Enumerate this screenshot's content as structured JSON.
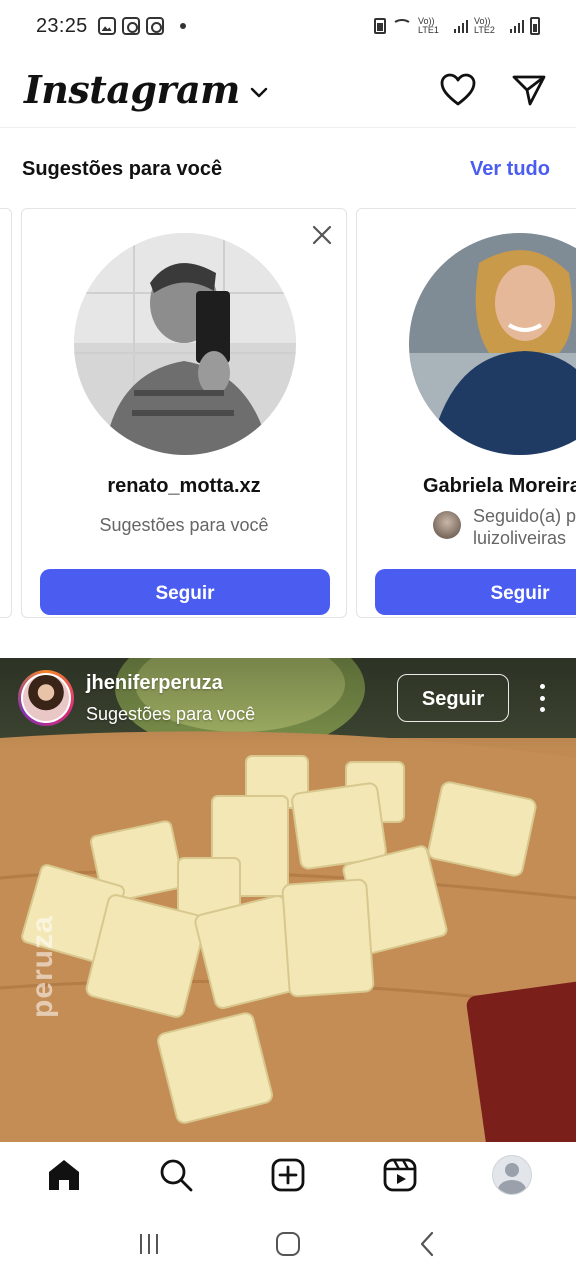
{
  "status_bar": {
    "time": "23:25",
    "net1": "Vo)) LTE1",
    "net2": "Vo)) LTE2"
  },
  "header": {
    "logo": "Instagram"
  },
  "suggestions": {
    "title": "Sugestões para você",
    "see_all": "Ver tudo",
    "cards": [
      {
        "username": "renato_motta.xz",
        "subtitle": "Sugestões para você",
        "follow_label": "Seguir"
      },
      {
        "username": "Gabriela Moreira",
        "mutual_line1": "Seguido(a) p",
        "mutual_line2": "luizoliveiras",
        "follow_label": "Seguir"
      }
    ]
  },
  "post": {
    "username": "jheniferperuza",
    "subtitle": "Sugestões para você",
    "follow_label": "Seguir",
    "watermark": "peruza"
  },
  "bottom_nav": {
    "items": [
      "home-icon",
      "search-icon",
      "create-icon",
      "reels-icon",
      "profile-avatar"
    ]
  },
  "colors": {
    "accent": "#4a5df0",
    "card_border": "#e4e4e4"
  }
}
